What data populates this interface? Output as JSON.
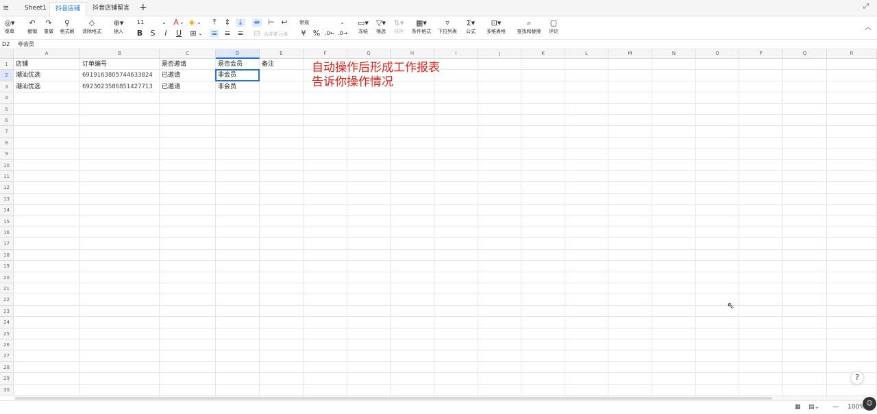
{
  "tabs": {
    "items": [
      "Sheet1",
      "抖音店铺",
      "抖音店铺留言"
    ],
    "active_index": 1,
    "add_label": "+"
  },
  "toolbar": {
    "menu": "菜单",
    "undo": "撤销",
    "redo": "重做",
    "format_painter": "格式刷",
    "clear_format": "清除格式",
    "insert": "插入",
    "font_size": "11",
    "bold": "B",
    "italic": "I",
    "underline": "U",
    "strike": "S",
    "merge": "合并单元格",
    "number_format": "常规",
    "currency": "¥",
    "percent": "%",
    "freeze": "冻结",
    "filter": "筛选",
    "sort": "排序",
    "conditional": "条件格式",
    "dropdown": "下拉列表",
    "formula": "公式",
    "pivot": "多维表格",
    "find_replace": "查找和替换",
    "comment": "评论"
  },
  "formula_bar": {
    "cell_ref": "D2",
    "value": "非会员"
  },
  "columns": [
    "A",
    "B",
    "C",
    "D",
    "E",
    "F",
    "G",
    "H",
    "I",
    "J",
    "K",
    "L",
    "M",
    "N",
    "O",
    "P",
    "Q",
    "R"
  ],
  "selected_column": "D",
  "selected_row": 2,
  "rows": [
    [
      "店铺",
      "订单编号",
      "是否邀请",
      "是否会员",
      "备注"
    ],
    [
      "潮汕优选",
      "6919163805744633824",
      "已邀请",
      "非会员",
      ""
    ],
    [
      "潮汕优选",
      "6923023586851427713",
      "已邀请",
      "非会员",
      ""
    ]
  ],
  "row_numbers": [
    "1",
    "2",
    "3",
    "4",
    "5",
    "6",
    "7",
    "8",
    "9",
    "10",
    "11",
    "12",
    "13",
    "14",
    "15",
    "16",
    "17",
    "18",
    "19",
    "20",
    "21",
    "22",
    "23",
    "24",
    "25",
    "26",
    "27",
    "28",
    "29",
    "30"
  ],
  "annotation": {
    "line1": "自动操作后形成工作报表",
    "line2": "告诉你操作情况",
    "color": "#e8201a"
  },
  "status": {
    "zoom": "100%"
  },
  "accent_color": "#1a73e8"
}
